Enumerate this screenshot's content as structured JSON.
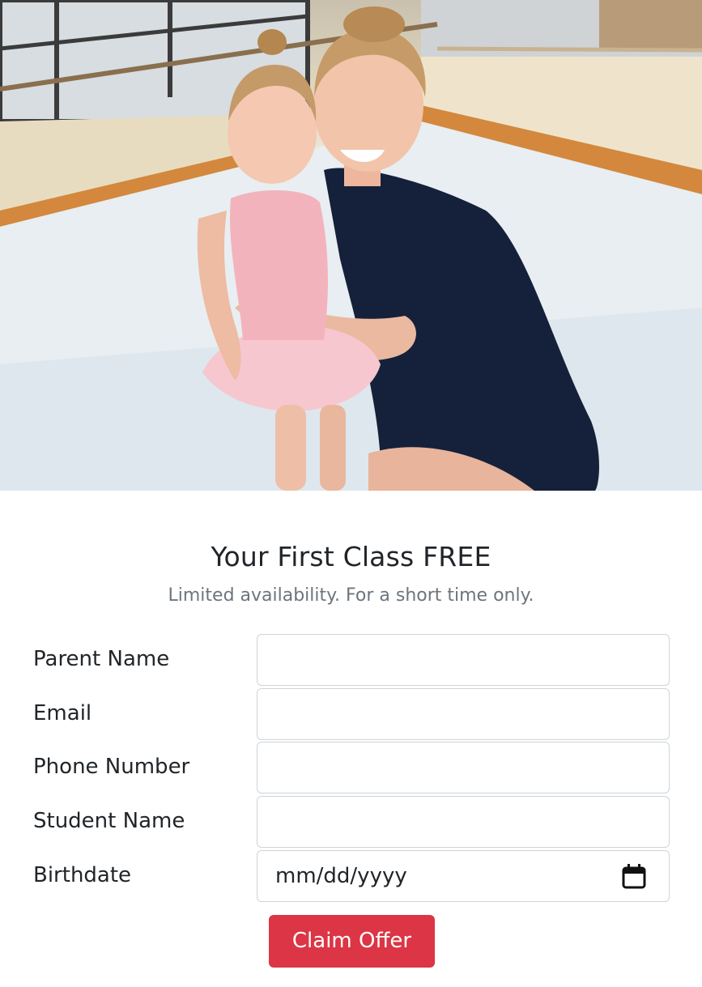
{
  "hero": {
    "image_name": "dance-teacher-and-student-photo"
  },
  "offer": {
    "title": "Your First Class FREE",
    "subtitle": "Limited availability. For a short time only."
  },
  "form": {
    "fields": [
      {
        "label": "Parent Name",
        "value": "",
        "placeholder": ""
      },
      {
        "label": "Email",
        "value": "",
        "placeholder": ""
      },
      {
        "label": "Phone Number",
        "value": "",
        "placeholder": ""
      },
      {
        "label": "Student Name",
        "value": "",
        "placeholder": ""
      },
      {
        "label": "Birthdate",
        "value": "",
        "placeholder": "mm/dd/yyyy",
        "icon": "calendar-icon"
      }
    ],
    "submit_label": "Claim Offer"
  },
  "colors": {
    "accent": "#dc3545",
    "muted_text": "#6c757d",
    "input_border": "#ced4da"
  }
}
